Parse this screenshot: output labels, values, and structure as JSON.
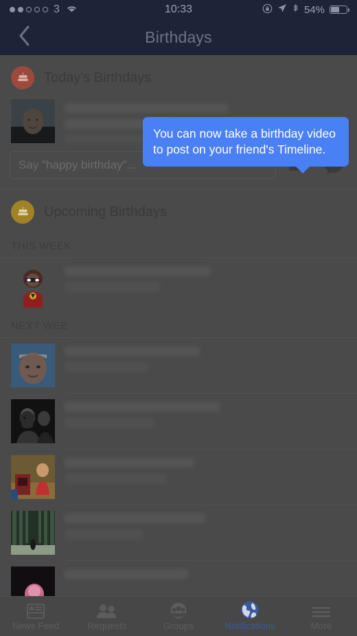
{
  "statusbar": {
    "carrier": "3",
    "signal_dots_filled": 2,
    "signal_dots_total": 5,
    "wifi_icon": "wifi-icon",
    "time": "10:33",
    "rotation_lock_icon": "rotation-lock-icon",
    "location_icon": "location-arrow-icon",
    "bluetooth_icon": "bluetooth-icon",
    "battery_percent": "54%",
    "battery_level": 54
  },
  "navbar": {
    "back_icon": "chevron-left-icon",
    "title": "Birthdays"
  },
  "today": {
    "badge_icon": "birthday-cake-icon",
    "badge_color": "#9c4a3d",
    "title": "Today's Birthdays",
    "composer_placeholder": "Say \"happy birthday\"...",
    "video_icon": "video-camera-icon",
    "messenger_icon": "messenger-icon"
  },
  "upcoming": {
    "badge_icon": "birthday-cake-icon",
    "badge_color": "#a08227",
    "title": "Upcoming Birthdays",
    "this_week_label": "THIS WEEK",
    "next_week_label": "NEXT WEE"
  },
  "tooltip": {
    "text": "You can now take a birthday video to post on your friend's Timeline.",
    "color": "#4a80f5"
  },
  "tabbar": {
    "items": [
      {
        "label": "News Feed",
        "icon": "news-feed-icon",
        "active": false
      },
      {
        "label": "Requests",
        "icon": "friend-requests-icon",
        "active": false
      },
      {
        "label": "Groups",
        "icon": "groups-icon",
        "active": false
      },
      {
        "label": "Notifications",
        "icon": "globe-icon",
        "active": true
      },
      {
        "label": "More",
        "icon": "hamburger-menu-icon",
        "active": false
      }
    ],
    "active_color": "#3b5998"
  }
}
